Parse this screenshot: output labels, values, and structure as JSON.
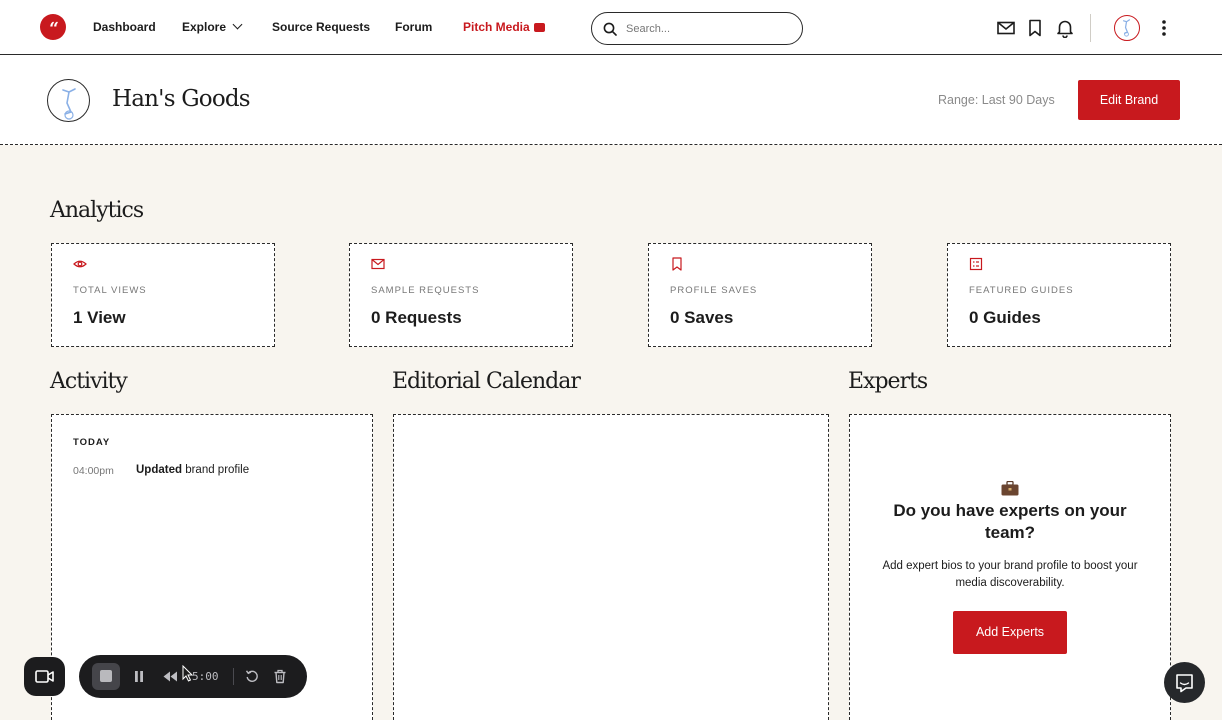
{
  "nav": {
    "items": [
      {
        "label": "Dashboard"
      },
      {
        "label": "Explore"
      },
      {
        "label": "Source Requests"
      },
      {
        "label": "Forum"
      },
      {
        "label": "Pitch Media"
      }
    ],
    "search_placeholder": "Search..."
  },
  "brand": {
    "name": "Han's Goods",
    "range": "Range: Last 90 Days",
    "edit_label": "Edit Brand"
  },
  "analytics": {
    "title": "Analytics",
    "stats": [
      {
        "icon": "eye-icon",
        "label": "TOTAL VIEWS",
        "value": "1 View"
      },
      {
        "icon": "mail-icon",
        "label": "SAMPLE REQUESTS",
        "value": "0 Requests"
      },
      {
        "icon": "bookmark-icon",
        "label": "PROFILE SAVES",
        "value": "0 Saves"
      },
      {
        "icon": "guide-icon",
        "label": "FEATURED GUIDES",
        "value": "0 Guides"
      }
    ]
  },
  "activity": {
    "title": "Activity",
    "group": "TODAY",
    "items": [
      {
        "time": "04:00pm",
        "action": "Updated",
        "detail": " brand profile"
      }
    ]
  },
  "calendar": {
    "title": "Editorial Calendar"
  },
  "experts": {
    "title": "Experts",
    "heading": "Do you have experts on your team?",
    "description": "Add expert bios to your brand profile to boost your media discoverability.",
    "button": "Add Experts"
  },
  "recorder": {
    "time": "5:00"
  },
  "colors": {
    "accent": "#c8191e",
    "background": "#f8f5ef",
    "text": "#1c1c1c"
  }
}
